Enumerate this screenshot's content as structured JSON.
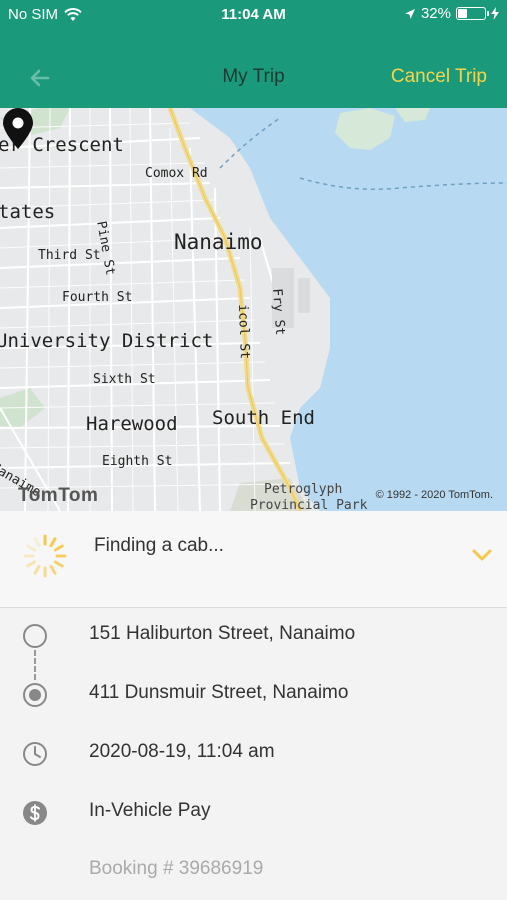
{
  "status_bar": {
    "carrier": "No SIM",
    "time": "11:04 AM",
    "battery": "32%",
    "battery_level": 0.32
  },
  "header": {
    "title": "My Trip",
    "cancel_label": "Cancel Trip",
    "back_icon": "arrow-left-icon",
    "color": "#1a9a7b",
    "accent": "#f6d54a"
  },
  "map": {
    "labels": {
      "crescent": "er Crescent",
      "comox": "Comox Rd",
      "estates": "tates",
      "pine": "Pine St",
      "nanaimo": "Nanaimo",
      "third": "Third St",
      "fourth": "Fourth St",
      "fry": "Fry St",
      "nicol": "icol St",
      "university": "University District",
      "sixth": "Sixth St",
      "harewood": "Harewood",
      "south_end": "South End",
      "eighth": "Eighth St",
      "nanaimo_road": "Nanaimo",
      "petroglyph": "Petroglyph",
      "provincial": "Provincial Park"
    },
    "brand": "TomTom",
    "copyright": "© 1992 - 2020 TomTom.",
    "pin_icon": "location-pin-icon"
  },
  "trip": {
    "status": "Finding a cab...",
    "pickup": "151 Haliburton Street, Nanaimo",
    "dropoff": "411 Dunsmuir Street, Nanaimo",
    "datetime": "2020-08-19, 11:04 am",
    "payment": "In-Vehicle Pay",
    "booking": "Booking # 39686919"
  }
}
